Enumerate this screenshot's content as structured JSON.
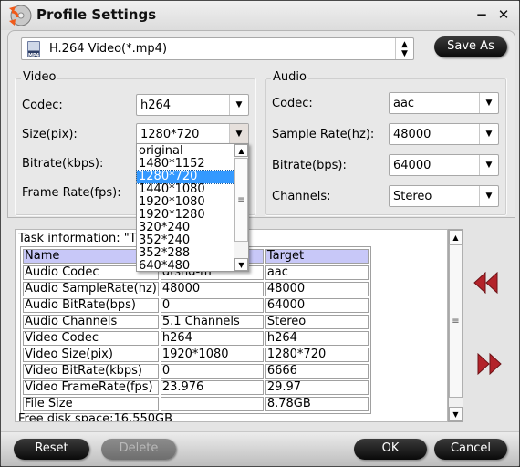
{
  "window": {
    "title": "Profile Settings",
    "minimize_label": "−",
    "close_label": "✕"
  },
  "profile": {
    "icon": "mp4-icon",
    "icon_text": "MP4",
    "value": "H.264 Video(*.mp4)",
    "spin_glyph": "▲▼",
    "save_as_label": "Save As"
  },
  "video": {
    "title": "Video",
    "codec_label": "Codec:",
    "codec_value": "h264",
    "size_label": "Size(pix):",
    "size_value": "1280*720",
    "bitrate_label": "Bitrate(kbps):",
    "framerate_label": "Frame Rate(fps):"
  },
  "audio": {
    "title": "Audio",
    "codec_label": "Codec:",
    "codec_value": "aac",
    "samplerate_label": "Sample Rate(hz):",
    "samplerate_value": "48000",
    "bitrate_label": "Bitrate(bps):",
    "bitrate_value": "64000",
    "channels_label": "Channels:",
    "channels_value": "Stereo"
  },
  "size_dropdown": {
    "options": [
      "original",
      "1480*1152",
      "1280*720",
      "1440*1080",
      "1920*1080",
      "1920*1280",
      "320*240",
      "352*240",
      "352*288",
      "640*480"
    ],
    "selected": "1280*720"
  },
  "task": {
    "info_label": "Task information: \"Titl",
    "headers": [
      "Name",
      "",
      "Target"
    ],
    "rows": [
      [
        "Audio Codec",
        "dtshd-m",
        "aac"
      ],
      [
        "Audio SampleRate(hz)",
        "48000",
        "48000"
      ],
      [
        "Audio BitRate(bps)",
        "0",
        "64000"
      ],
      [
        "Audio Channels",
        "5.1 Channels",
        "Stereo"
      ],
      [
        "Video Codec",
        "h264",
        "h264"
      ],
      [
        "Video Size(pix)",
        "1920*1080",
        "1280*720"
      ],
      [
        "Video BitRate(kbps)",
        "0",
        "6666"
      ],
      [
        "Video FrameRate(fps)",
        "23.976",
        "29.97"
      ],
      [
        "File Size",
        "",
        "8.78GB"
      ]
    ],
    "free_disk": "Free disk space:16.550GB"
  },
  "nav": {
    "back_icon": "rewind-icon",
    "forward_icon": "fast-forward-icon",
    "accent_color": "#b3232a"
  },
  "buttons": {
    "reset": "Reset",
    "delete": "Delete",
    "ok": "OK",
    "cancel": "Cancel"
  }
}
